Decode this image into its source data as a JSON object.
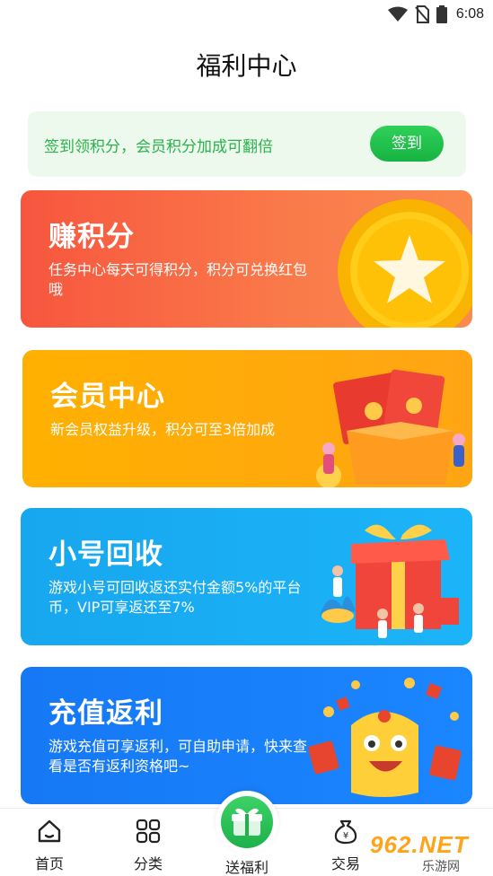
{
  "status_bar": {
    "time": "6:08"
  },
  "header": {
    "title": "福利中心"
  },
  "signin": {
    "text": "签到领积分，会员积分加成可翻倍",
    "button_label": "签到"
  },
  "cards": [
    {
      "title": "赚积分",
      "desc": "任务中心每天可得积分，积分可兑换红包哦",
      "art": "gold-coin-star"
    },
    {
      "title": "会员中心",
      "desc": "新会员权益升级，积分可至3倍加成",
      "art": "red-envelope-gift-box"
    },
    {
      "title": "小号回收",
      "desc": "游戏小号可回收返还实付金额5%的平台币，VIP可享返还至7%",
      "art": "gift-box-people"
    },
    {
      "title": "充值返利",
      "desc": "游戏充值可享返利，可自助申请，快来查看是否有返利资格吧~",
      "art": "mascot-red-envelopes"
    }
  ],
  "bottom_nav": {
    "items": [
      {
        "label": "首页",
        "icon": "home-icon"
      },
      {
        "label": "分类",
        "icon": "grid-icon"
      },
      {
        "label": "送福利",
        "icon": "gift-icon"
      },
      {
        "label": "交易",
        "icon": "money-bag-icon"
      }
    ]
  },
  "watermark": {
    "text": "962.NET",
    "sub": "乐游网"
  },
  "colors": {
    "accent_green": "#2bb24c",
    "points_card": "#f7563e",
    "vip_card": "#ffb000",
    "recycle_card": "#17a7ef",
    "rebate_card": "#1678f5"
  }
}
